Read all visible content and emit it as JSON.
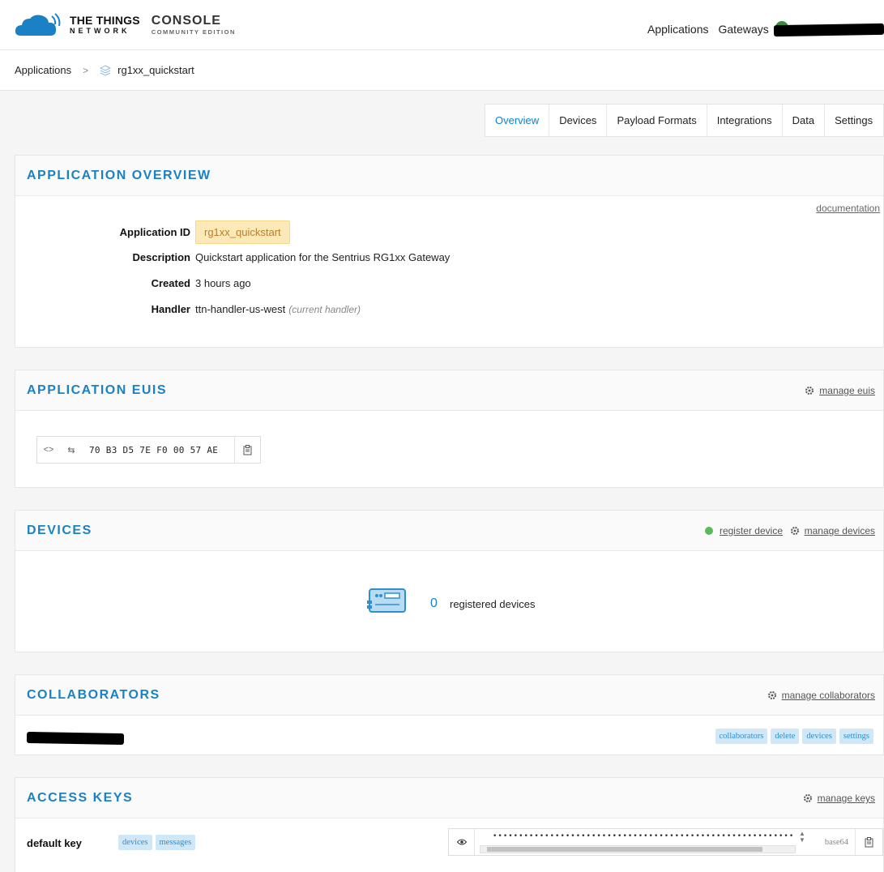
{
  "header": {
    "brand_line1": "THE THINGS",
    "brand_line2": "NETWORK",
    "console": "CONSOLE",
    "edition": "COMMUNITY EDITION",
    "nav": [
      "Applications",
      "Gateways"
    ]
  },
  "breadcrumb": {
    "root": "Applications",
    "separator": ">",
    "current": "rg1xx_quickstart"
  },
  "tabs": [
    "Overview",
    "Devices",
    "Payload Formats",
    "Integrations",
    "Data",
    "Settings"
  ],
  "active_tab": "Overview",
  "overview": {
    "title": "APPLICATION OVERVIEW",
    "documentation_link": "documentation",
    "application_id_label": "Application ID",
    "application_id": "rg1xx_quickstart",
    "description_label": "Description",
    "description": "Quickstart application for the Sentrius RG1xx Gateway",
    "created_label": "Created",
    "created": "3 hours ago",
    "handler_label": "Handler",
    "handler": "ttn-handler-us-west",
    "handler_note": "(current handler)"
  },
  "euis": {
    "title": "APPLICATION EUIS",
    "manage_link": "manage euis",
    "value": "70 B3 D5 7E F0 00 57 AE"
  },
  "devices": {
    "title": "DEVICES",
    "register_link": "register device",
    "manage_link": "manage devices",
    "count": "0",
    "count_label": "registered devices"
  },
  "collaborators": {
    "title": "COLLABORATORS",
    "manage_link": "manage collaborators",
    "rights": [
      "collaborators",
      "delete",
      "devices",
      "settings"
    ]
  },
  "access_keys": {
    "title": "ACCESS KEYS",
    "manage_link": "manage keys",
    "keys": [
      {
        "name": "default key",
        "rights": [
          "devices",
          "messages"
        ],
        "masked": "••••••••••••••••••••••••••••••••••••••••••••••••••••••••••••",
        "encoding": "base64"
      }
    ]
  },
  "colors": {
    "accent": "#1a82c4",
    "active_tab": "#0d83d0",
    "appid_chip": "#fde9b8",
    "badge_bg": "#cfe7f7"
  }
}
